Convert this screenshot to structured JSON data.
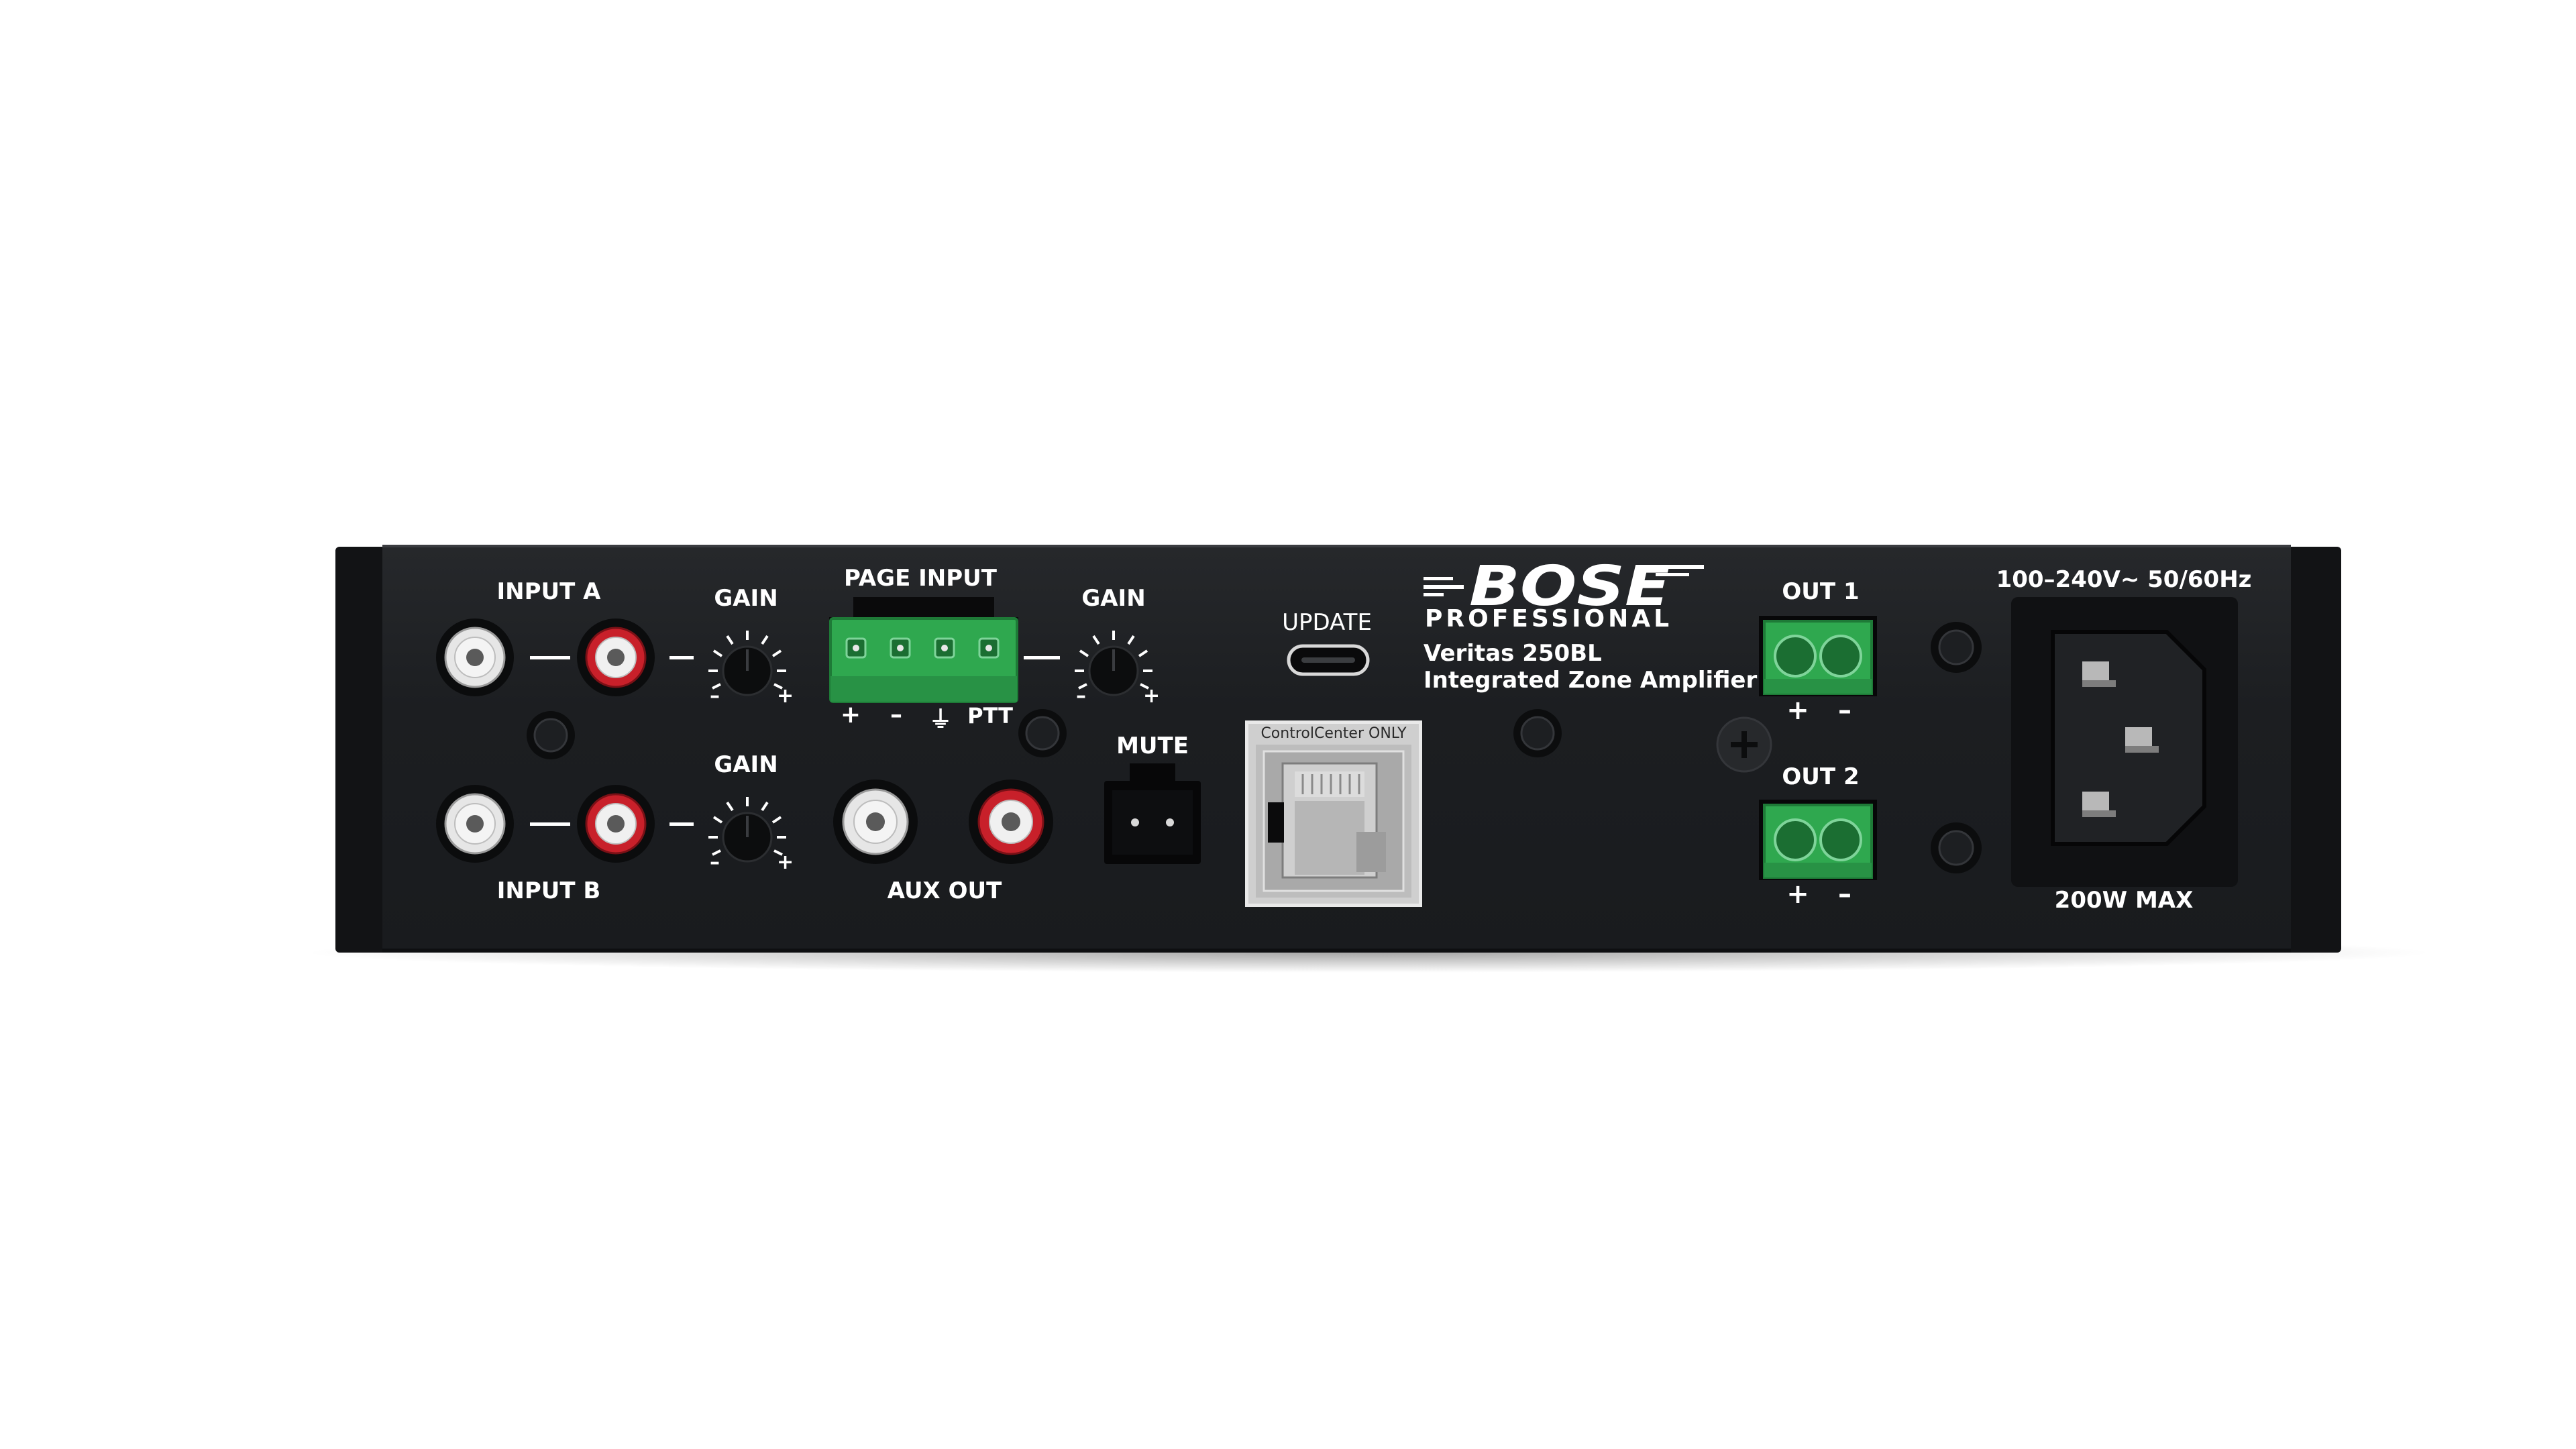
{
  "brand": {
    "logo_text": "BOSE",
    "sub_brand": "PROFESSIONAL",
    "model": "Veritas 250BL",
    "description": "Integrated Zone Amplifier"
  },
  "labels": {
    "input_a": "INPUT A",
    "input_b": "INPUT B",
    "gain": "GAIN",
    "page_input": "PAGE INPUT",
    "page_terminals": [
      "+",
      "–",
      "⏚",
      "PTT"
    ],
    "aux_out": "AUX OUT",
    "mute": "MUTE",
    "update": "UPDATE",
    "control_center": "ControlCenter ONLY",
    "out1": "OUT 1",
    "out2": "OUT 2",
    "plus": "+",
    "minus": "–",
    "power_rating": "100–240V~ 50/60Hz",
    "max_power": "200W MAX"
  },
  "colors": {
    "panel": "#1d1f22",
    "rca_red": "#c8202a",
    "rca_white": "#e8e8e8",
    "terminal_green": "#2fa84f"
  }
}
